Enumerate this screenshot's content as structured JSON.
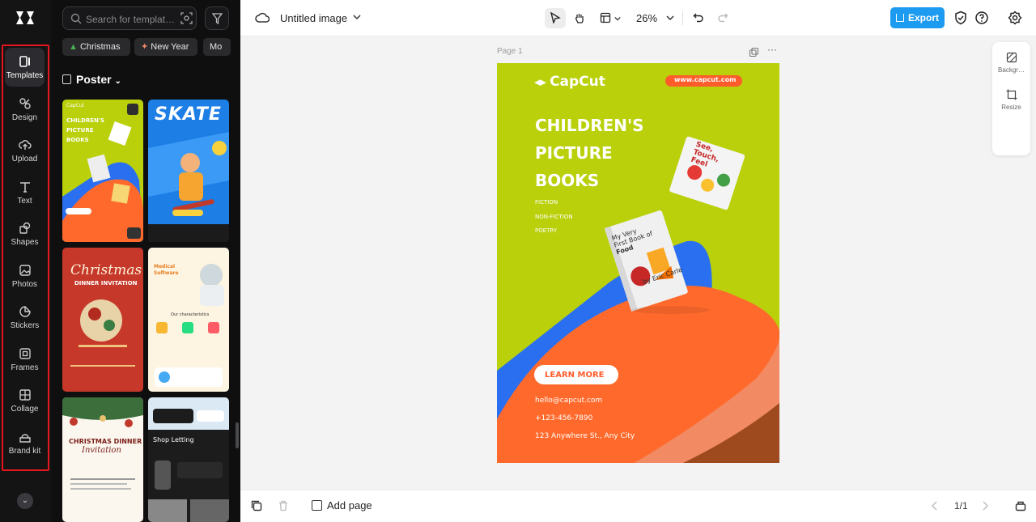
{
  "rail": {
    "items": [
      {
        "label": "Templates",
        "icon": "templates-icon"
      },
      {
        "label": "Design",
        "icon": "design-icon"
      },
      {
        "label": "Upload",
        "icon": "upload-icon"
      },
      {
        "label": "Text",
        "icon": "text-icon"
      },
      {
        "label": "Shapes",
        "icon": "shapes-icon"
      },
      {
        "label": "Photos",
        "icon": "photos-icon"
      },
      {
        "label": "Stickers",
        "icon": "stickers-icon"
      },
      {
        "label": "Frames",
        "icon": "frames-icon"
      },
      {
        "label": "Collage",
        "icon": "collage-icon"
      },
      {
        "label": "Brand kit",
        "icon": "brand-kit-icon"
      }
    ]
  },
  "panel": {
    "search_placeholder": "Search for templat…",
    "chips": [
      "Christmas",
      "New Year",
      "Mo"
    ],
    "section": "Poster",
    "thumbs": [
      {
        "title": "CHILDREN'S PICTURE BOOKS"
      },
      {
        "title": "SKATE"
      },
      {
        "title": "Christmas",
        "subtitle": "DINNER INVITATION"
      },
      {
        "title": "Medical Software",
        "subtitle": "Our characteristics"
      },
      {
        "title": "CHRISTMAS DINNER",
        "subtitle": "Invitation"
      },
      {
        "title": "Shop Letting"
      }
    ]
  },
  "topbar": {
    "doc_title": "Untitled image",
    "zoom": "26%",
    "export_label": "Export"
  },
  "canvas": {
    "page_label": "Page 1",
    "side_tools": [
      {
        "label": "Backgr…",
        "icon": "background-icon"
      },
      {
        "label": "Resize",
        "icon": "resize-icon"
      }
    ]
  },
  "poster": {
    "brand": "CapCut",
    "url": "www.capcut.com",
    "title_lines": [
      "CHILDREN'S",
      "PICTURE",
      "BOOKS"
    ],
    "genres": [
      "FICTION",
      "NON-FICTION",
      "POETRY"
    ],
    "cta": "LEARN MORE",
    "email": "hello@capcut.com",
    "phone": "+123-456-7890",
    "address": "123 Anywhere St., Any City",
    "book1_lines": [
      "See,",
      "Touch,",
      "Feel"
    ],
    "book2_lines": [
      "My Very",
      "First Book of",
      "Food",
      "by Eric Carle"
    ]
  },
  "bottombar": {
    "add_page": "Add page",
    "pager": "1/1"
  },
  "colors": {
    "poster_green": "#b9d00b",
    "poster_orange": "#ff6a2c",
    "poster_blue": "#2a6ff0",
    "export_blue": "#1d9bf0",
    "highlight_red": "#e5161f"
  }
}
